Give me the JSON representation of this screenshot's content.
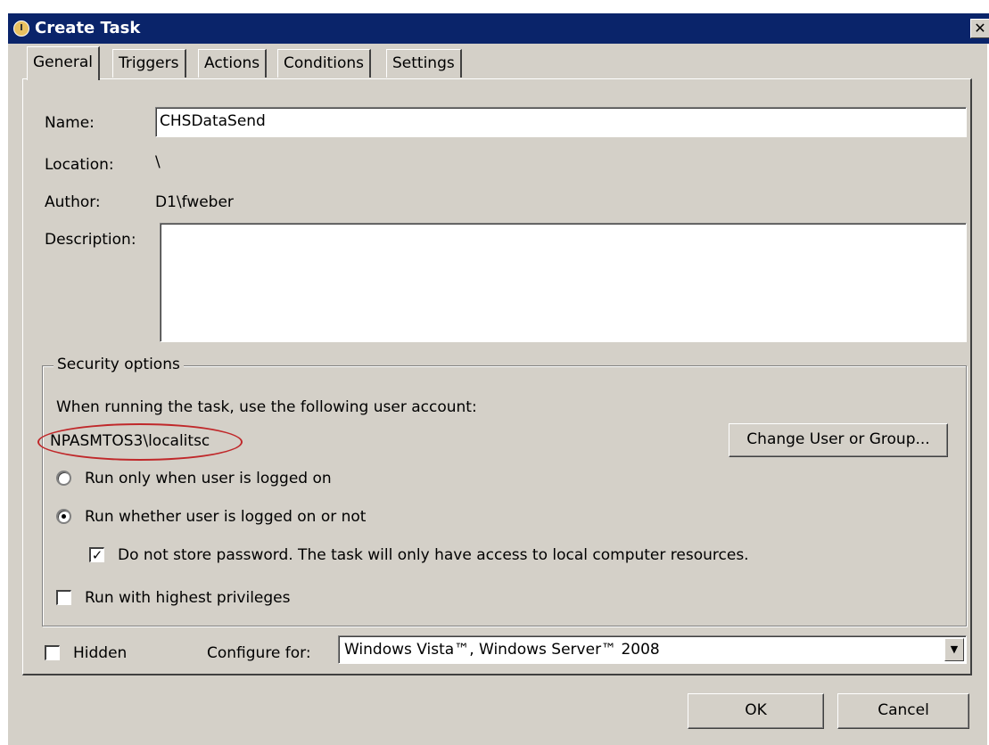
{
  "window": {
    "title": "Create Task",
    "close_glyph": "✕"
  },
  "tabs": [
    {
      "label": "General"
    },
    {
      "label": "Triggers"
    },
    {
      "label": "Actions"
    },
    {
      "label": "Conditions"
    },
    {
      "label": "Settings"
    }
  ],
  "general": {
    "name_label": "Name:",
    "name_value": "CHSDataSend",
    "location_label": "Location:",
    "location_value": "\\",
    "author_label": "Author:",
    "author_value": "D1\\fweber",
    "description_label": "Description:",
    "description_value": ""
  },
  "security": {
    "group_title": "Security options",
    "account_prompt": "When running the task, use the following user account:",
    "account_value": "NPASMTOS3\\localitsc",
    "change_button": "Change User or Group...",
    "radio_logged_on": "Run only when user is logged on",
    "radio_whether": "Run whether user is logged on or not",
    "selected_radio": "Run whether user is logged on or not",
    "no_store_password": "Do not store password.  The task will only have access to local computer resources.",
    "no_store_password_checked": true,
    "highest_privileges": "Run with highest privileges",
    "highest_privileges_checked": false
  },
  "footer": {
    "hidden_label": "Hidden",
    "hidden_checked": false,
    "configure_label": "Configure for:",
    "configure_value": "Windows Vista™, Windows Server™ 2008",
    "ok_button": "OK",
    "cancel_button": "Cancel"
  },
  "colors": {
    "titlebar": "#0a246a",
    "dialog_face": "#d4d0c8",
    "annotation_ellipse": "#c0282a"
  },
  "icons": {
    "title": "task-scheduler-icon",
    "close": "close-icon",
    "dropdown": "chevron-down-icon",
    "check": "checkmark-icon"
  }
}
